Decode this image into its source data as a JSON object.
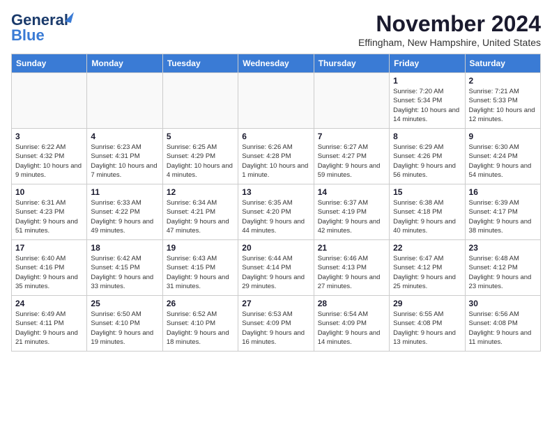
{
  "logo": {
    "line1": "General",
    "line2": "Blue"
  },
  "title": "November 2024",
  "location": "Effingham, New Hampshire, United States",
  "weekdays": [
    "Sunday",
    "Monday",
    "Tuesday",
    "Wednesday",
    "Thursday",
    "Friday",
    "Saturday"
  ],
  "weeks": [
    [
      {
        "day": "",
        "info": ""
      },
      {
        "day": "",
        "info": ""
      },
      {
        "day": "",
        "info": ""
      },
      {
        "day": "",
        "info": ""
      },
      {
        "day": "",
        "info": ""
      },
      {
        "day": "1",
        "info": "Sunrise: 7:20 AM\nSunset: 5:34 PM\nDaylight: 10 hours and 14 minutes."
      },
      {
        "day": "2",
        "info": "Sunrise: 7:21 AM\nSunset: 5:33 PM\nDaylight: 10 hours and 12 minutes."
      }
    ],
    [
      {
        "day": "3",
        "info": "Sunrise: 6:22 AM\nSunset: 4:32 PM\nDaylight: 10 hours and 9 minutes."
      },
      {
        "day": "4",
        "info": "Sunrise: 6:23 AM\nSunset: 4:31 PM\nDaylight: 10 hours and 7 minutes."
      },
      {
        "day": "5",
        "info": "Sunrise: 6:25 AM\nSunset: 4:29 PM\nDaylight: 10 hours and 4 minutes."
      },
      {
        "day": "6",
        "info": "Sunrise: 6:26 AM\nSunset: 4:28 PM\nDaylight: 10 hours and 1 minute."
      },
      {
        "day": "7",
        "info": "Sunrise: 6:27 AM\nSunset: 4:27 PM\nDaylight: 9 hours and 59 minutes."
      },
      {
        "day": "8",
        "info": "Sunrise: 6:29 AM\nSunset: 4:26 PM\nDaylight: 9 hours and 56 minutes."
      },
      {
        "day": "9",
        "info": "Sunrise: 6:30 AM\nSunset: 4:24 PM\nDaylight: 9 hours and 54 minutes."
      }
    ],
    [
      {
        "day": "10",
        "info": "Sunrise: 6:31 AM\nSunset: 4:23 PM\nDaylight: 9 hours and 51 minutes."
      },
      {
        "day": "11",
        "info": "Sunrise: 6:33 AM\nSunset: 4:22 PM\nDaylight: 9 hours and 49 minutes."
      },
      {
        "day": "12",
        "info": "Sunrise: 6:34 AM\nSunset: 4:21 PM\nDaylight: 9 hours and 47 minutes."
      },
      {
        "day": "13",
        "info": "Sunrise: 6:35 AM\nSunset: 4:20 PM\nDaylight: 9 hours and 44 minutes."
      },
      {
        "day": "14",
        "info": "Sunrise: 6:37 AM\nSunset: 4:19 PM\nDaylight: 9 hours and 42 minutes."
      },
      {
        "day": "15",
        "info": "Sunrise: 6:38 AM\nSunset: 4:18 PM\nDaylight: 9 hours and 40 minutes."
      },
      {
        "day": "16",
        "info": "Sunrise: 6:39 AM\nSunset: 4:17 PM\nDaylight: 9 hours and 38 minutes."
      }
    ],
    [
      {
        "day": "17",
        "info": "Sunrise: 6:40 AM\nSunset: 4:16 PM\nDaylight: 9 hours and 35 minutes."
      },
      {
        "day": "18",
        "info": "Sunrise: 6:42 AM\nSunset: 4:15 PM\nDaylight: 9 hours and 33 minutes."
      },
      {
        "day": "19",
        "info": "Sunrise: 6:43 AM\nSunset: 4:15 PM\nDaylight: 9 hours and 31 minutes."
      },
      {
        "day": "20",
        "info": "Sunrise: 6:44 AM\nSunset: 4:14 PM\nDaylight: 9 hours and 29 minutes."
      },
      {
        "day": "21",
        "info": "Sunrise: 6:46 AM\nSunset: 4:13 PM\nDaylight: 9 hours and 27 minutes."
      },
      {
        "day": "22",
        "info": "Sunrise: 6:47 AM\nSunset: 4:12 PM\nDaylight: 9 hours and 25 minutes."
      },
      {
        "day": "23",
        "info": "Sunrise: 6:48 AM\nSunset: 4:12 PM\nDaylight: 9 hours and 23 minutes."
      }
    ],
    [
      {
        "day": "24",
        "info": "Sunrise: 6:49 AM\nSunset: 4:11 PM\nDaylight: 9 hours and 21 minutes."
      },
      {
        "day": "25",
        "info": "Sunrise: 6:50 AM\nSunset: 4:10 PM\nDaylight: 9 hours and 19 minutes."
      },
      {
        "day": "26",
        "info": "Sunrise: 6:52 AM\nSunset: 4:10 PM\nDaylight: 9 hours and 18 minutes."
      },
      {
        "day": "27",
        "info": "Sunrise: 6:53 AM\nSunset: 4:09 PM\nDaylight: 9 hours and 16 minutes."
      },
      {
        "day": "28",
        "info": "Sunrise: 6:54 AM\nSunset: 4:09 PM\nDaylight: 9 hours and 14 minutes."
      },
      {
        "day": "29",
        "info": "Sunrise: 6:55 AM\nSunset: 4:08 PM\nDaylight: 9 hours and 13 minutes."
      },
      {
        "day": "30",
        "info": "Sunrise: 6:56 AM\nSunset: 4:08 PM\nDaylight: 9 hours and 11 minutes."
      }
    ]
  ]
}
